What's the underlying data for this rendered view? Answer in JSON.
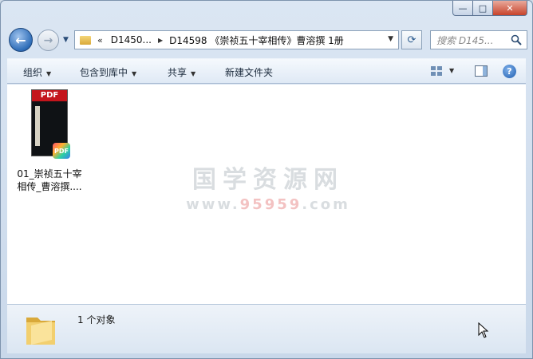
{
  "window": {
    "caption_buttons": {
      "minimize": "—",
      "maximize": "□",
      "close": "✕"
    }
  },
  "nav": {
    "back_icon": "arrow-left-icon",
    "forward_icon": "arrow-right-icon",
    "address": {
      "overflow": "«",
      "crumbs": [
        "D1450...",
        "D14598 《崇祯五十宰相传》曹溶撰 1册"
      ]
    },
    "search_placeholder": "搜索 D145..."
  },
  "toolbar": {
    "organize": "组织",
    "include_library": "包含到库中",
    "share": "共享",
    "new_folder": "新建文件夹"
  },
  "files": [
    {
      "name": "01_崇祯五十宰相传_曹溶撰....",
      "name_line1": "01_崇祯五十宰",
      "name_line2": "相传_曹溶撰....",
      "thumb_header": "PDF",
      "badge": "PDF"
    }
  ],
  "watermark": {
    "line1": "国学资源网",
    "line2_prefix": "www.",
    "line2_accent": "95959",
    "line2_suffix": ".com"
  },
  "status": {
    "count_text": "1 个对象"
  },
  "colors": {
    "close": "#c7432b",
    "pdf_red": "#c4151c",
    "window_frame": "#cfdbe8"
  }
}
